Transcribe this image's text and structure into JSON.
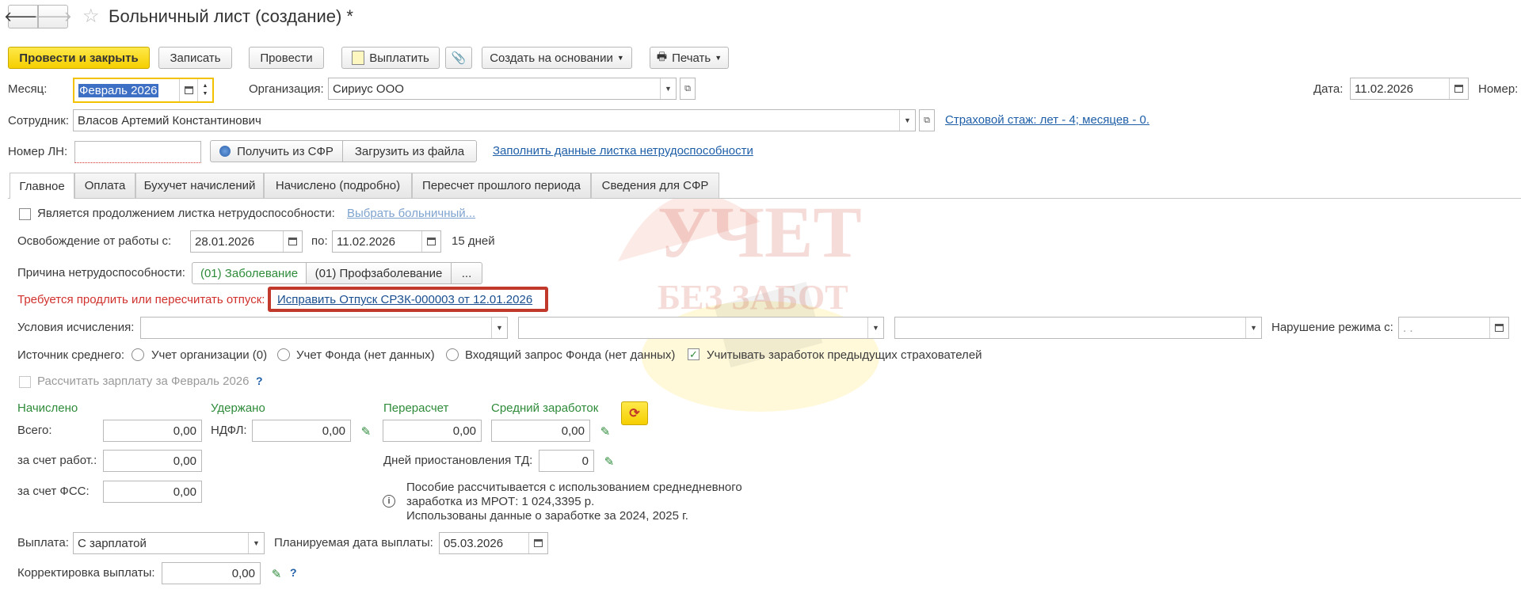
{
  "window": {
    "title": "Больничный лист (создание) *"
  },
  "toolbar": {
    "post_close": "Провести и закрыть",
    "save": "Записать",
    "post": "Провести",
    "pay": "Выплатить",
    "create_based": "Создать на основании",
    "print": "Печать"
  },
  "header": {
    "month_label": "Месяц:",
    "month_value": "Февраль 2026",
    "org_label": "Организация:",
    "org_value": "Сириус ООО",
    "date_label": "Дата:",
    "date_value": "11.02.2026",
    "number_label": "Номер:",
    "employee_label": "Сотрудник:",
    "employee_value": "Власов Артемий Константинович",
    "insurance_link": "Страховой стаж: лет - 4; месяцев - 0.",
    "ln_label": "Номер ЛН:",
    "ln_value": "",
    "get_sfr": "Получить из СФР",
    "load_file": "Загрузить из файла",
    "fill_link": "Заполнить данные листка нетрудоспособности"
  },
  "tabs": [
    {
      "label": "Главное"
    },
    {
      "label": "Оплата"
    },
    {
      "label": "Бухучет начислений"
    },
    {
      "label": "Начислено (подробно)"
    },
    {
      "label": "Пересчет прошлого периода"
    },
    {
      "label": "Сведения для СФР"
    }
  ],
  "main": {
    "continuation_label": "Является продолжением листка нетрудоспособности:",
    "choose_link": "Выбрать больничный...",
    "release_label": "Освобождение от работы с:",
    "release_from": "28.01.2026",
    "to_label": "по:",
    "release_to": "11.02.2026",
    "days": "15 дней",
    "reason_label": "Причина нетрудоспособности:",
    "reason_1": "(01) Заболевание",
    "reason_2": "(01) Профзаболевание",
    "reason_more": "...",
    "warning_label": "Требуется продлить или пересчитать отпуск:",
    "warning_link": "Исправить Отпуск СРЗК-000003 от 12.01.2026",
    "conditions_label": "Условия исчисления:",
    "violation_label": "Нарушение режима с:",
    "violation_value": " .  .",
    "source_label": "Источник среднего:",
    "source_opt1": "Учет организации (0)",
    "source_opt2": "Учет Фонда (нет данных)",
    "source_opt3": "Входящий запрос Фонда (нет данных)",
    "prev_insurers": "Учитывать заработок предыдущих страхователей",
    "calc_salary": "Рассчитать зарплату за Февраль 2026",
    "help": "?"
  },
  "totals": {
    "accrued_header": "Начислено",
    "withheld_header": "Удержано",
    "recalc_header": "Перерасчет",
    "avg_header": "Средний заработок",
    "total_label": "Всего:",
    "total_value": "0,00",
    "ndfl_label": "НДФЛ:",
    "ndfl_value": "0,00",
    "recalc_value": "0,00",
    "avg_value": "0,00",
    "employer_label": "за счет работ.:",
    "employer_value": "0,00",
    "fss_label": "за счет ФСС:",
    "fss_value": "0,00",
    "suspend_label": "Дней приостановления ТД:",
    "suspend_value": "0",
    "info_line1": "Пособие рассчитывается с использованием среднедневного",
    "info_line2": "заработка из МРОТ: 1 024,3395 р.",
    "info_line3": "Использованы данные о заработке за  2024,  2025 г."
  },
  "payment": {
    "payout_label": "Выплата:",
    "payout_value": "С зарплатой",
    "planned_label": "Планируемая дата выплаты:",
    "planned_value": "05.03.2026",
    "correction_label": "Корректировка выплаты:",
    "correction_value": "0,00"
  },
  "watermark": {
    "line1": "УЧЕТ",
    "line2": "БЕЗ ЗАБОТ"
  },
  "colors": {
    "accent_yellow": "#f5cf00",
    "link_blue": "#1f5fa8",
    "warning_red": "#d0312d",
    "green": "#2e8b3a"
  }
}
